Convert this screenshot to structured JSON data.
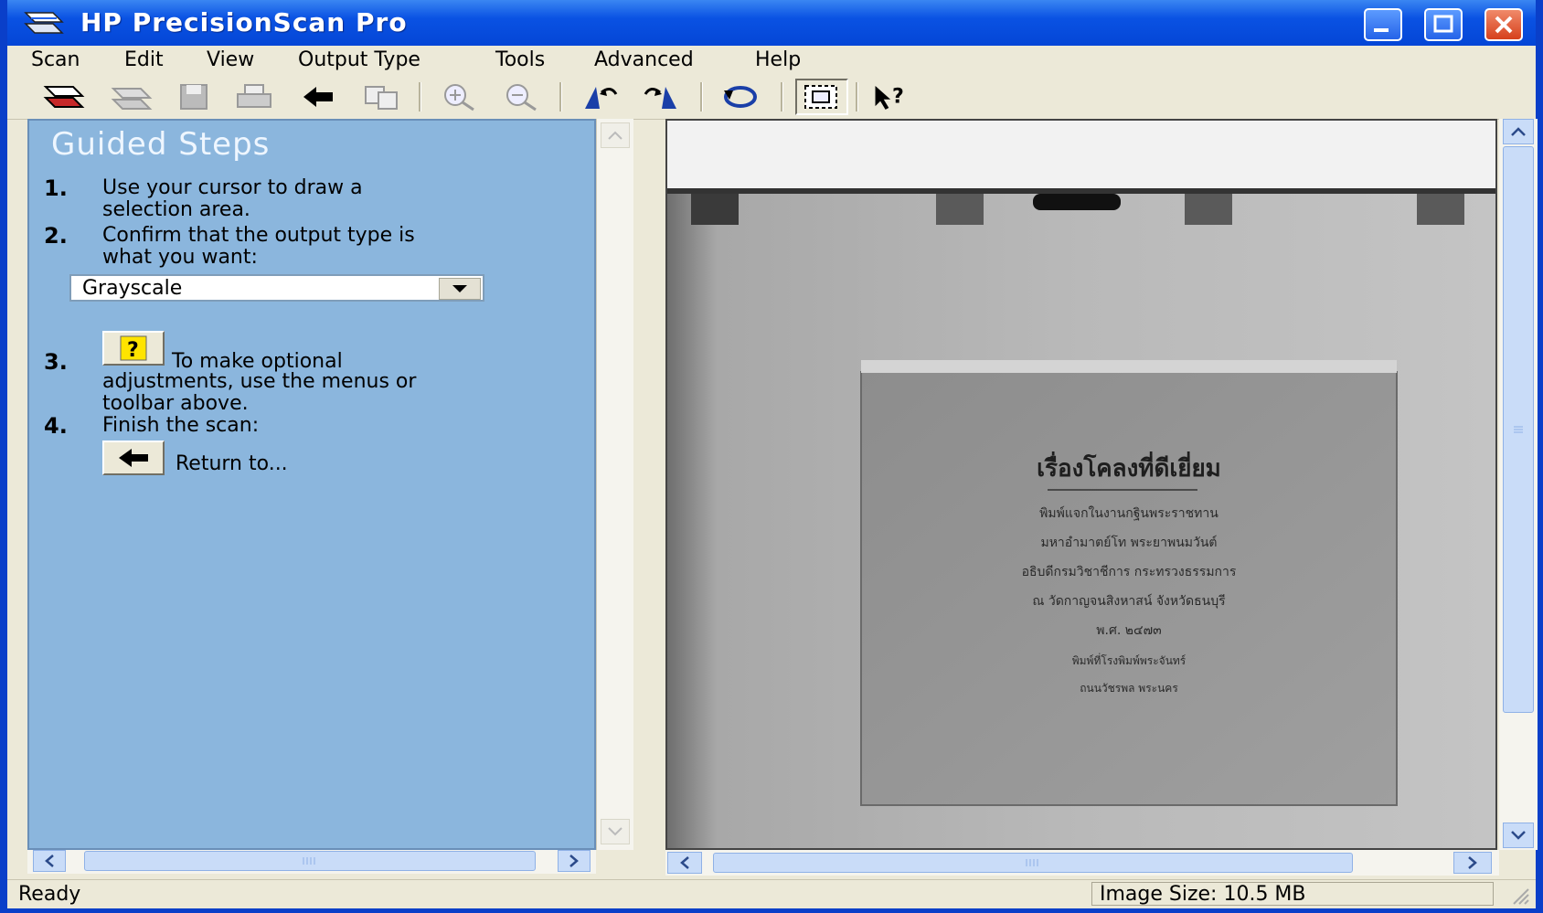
{
  "window": {
    "title": "HP PrecisionScan Pro"
  },
  "menu": [
    "Scan",
    "Edit",
    "View",
    "Output Type",
    "Tools",
    "Advanced",
    "Help"
  ],
  "guided": {
    "title": "Guided Steps",
    "steps": [
      {
        "num": "1.",
        "line1": "Use your cursor to draw a",
        "line2": "selection area."
      },
      {
        "num": "2.",
        "line1": "Confirm that the output type is",
        "line2": "what you want:"
      },
      {
        "num": "3.",
        "line1": "To make optional",
        "line2": "adjustments, use the menus or",
        "line3": "toolbar above."
      },
      {
        "num": "4.",
        "line1": "Finish the scan:"
      }
    ],
    "output_type": "Grayscale",
    "return_label": "Return to..."
  },
  "book": {
    "title": "เรื่องโคลงที่ดีเยี่ยม",
    "line1": "พิมพ์แจกในงานกฐินพระราชทาน",
    "line2": "มหาอำมาตย์โท พระยาพนมวันต์",
    "line3": "อธิบดีกรมวิชาชีการ กระทรวงธรรมการ",
    "line4": "ณ วัดกาญจนสิงหาสน์ จังหวัดธนบุรี",
    "line5": "พ.ศ. ๒๔๗๓",
    "line6": "พิมพ์ที่โรงพิมพ์พระจันทร์",
    "line7": "ถนนวัชรพล พระนคร"
  },
  "status": {
    "left": "Ready",
    "right": "Image Size:  10.5 MB"
  },
  "icons": [
    "scan-icon",
    "rescan-icon",
    "save-icon",
    "print-icon",
    "back-arrow-icon",
    "copy-icon",
    "zoom-in-icon",
    "zoom-out-icon",
    "flip-left-icon",
    "flip-right-icon",
    "rotate-icon",
    "select-area-icon",
    "help-pointer-icon"
  ]
}
